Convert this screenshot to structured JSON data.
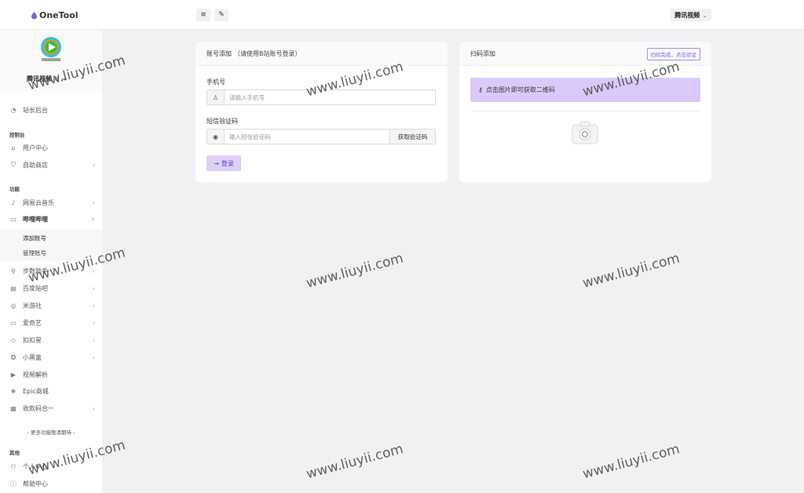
{
  "app": {
    "logo_text": "OneTool"
  },
  "topbar": {
    "menu_icon": "≡",
    "brush_icon": "✎",
    "user_label": "腾讯视频",
    "user_chevron": "⌄"
  },
  "sidebar": {
    "profile_name": "腾讯视频",
    "items": [
      {
        "label": "站长后台",
        "icon": "gauge-icon",
        "glyph": "◔"
      },
      {
        "section": "控制台"
      },
      {
        "label": "用户中心",
        "icon": "home-icon",
        "glyph": "⌂"
      },
      {
        "label": "自助商店",
        "icon": "cart-icon",
        "glyph": "⛉",
        "chevron": "‹"
      },
      {
        "section": "功能"
      },
      {
        "label": "网易云音乐",
        "icon": "music-icon",
        "glyph": "♪",
        "chevron": "‹"
      },
      {
        "label": "哔哩哔哩",
        "icon": "bilibili-icon",
        "glyph": "▭",
        "chevron": "»",
        "active": true
      },
      {
        "label": "添加账号"
      },
      {
        "label": "管理账号"
      },
      {
        "label": "步数助手",
        "icon": "shoe-icon",
        "glyph": "⚲",
        "chevron": "‹"
      },
      {
        "label": "百度贴吧",
        "icon": "news-icon",
        "glyph": "▤",
        "chevron": "‹"
      },
      {
        "label": "米游社",
        "icon": "location-icon",
        "glyph": "◎",
        "chevron": "‹"
      },
      {
        "label": "爱奇艺",
        "icon": "monitor-icon",
        "glyph": "▭",
        "chevron": "‹"
      },
      {
        "label": "扣扣星",
        "icon": "graduation-icon",
        "glyph": "◇",
        "chevron": "‹"
      },
      {
        "label": "小黑盒",
        "icon": "badge-icon",
        "glyph": "✪",
        "chevron": "‹"
      },
      {
        "label": "视频解析",
        "icon": "video-icon",
        "glyph": "▶"
      },
      {
        "label": "Epic商城",
        "icon": "palette-icon",
        "glyph": "❀"
      },
      {
        "label": "收款码合一",
        "icon": "qrcode-icon",
        "glyph": "▦",
        "chevron": "‹"
      },
      {
        "more": "- 更多功能敬请期待 -"
      },
      {
        "section": "其他"
      },
      {
        "label": "个人中心",
        "icon": "user-icon",
        "glyph": "⚇"
      },
      {
        "label": "帮助中心",
        "icon": "info-icon",
        "glyph": "ⓘ"
      }
    ]
  },
  "account_card": {
    "title": "账号添加",
    "hint": "（请使用B站账号登录）",
    "phone_label": "手机号",
    "phone_placeholder": "请输入手机号",
    "code_label": "短信验证码",
    "code_placeholder": "输入短信验证码",
    "get_code_button": "获取验证码",
    "login_button": "登录"
  },
  "qr_card": {
    "title": "扫码添加",
    "done_button": "扫码完成，点击验证",
    "alert_text": "点击图片即可获取二维码"
  },
  "watermark": "www.liuyii.com",
  "colors": {
    "accent": "#7c5fd3",
    "alert_bg": "#dcc9fb",
    "login_bg": "#ddd0f7"
  }
}
